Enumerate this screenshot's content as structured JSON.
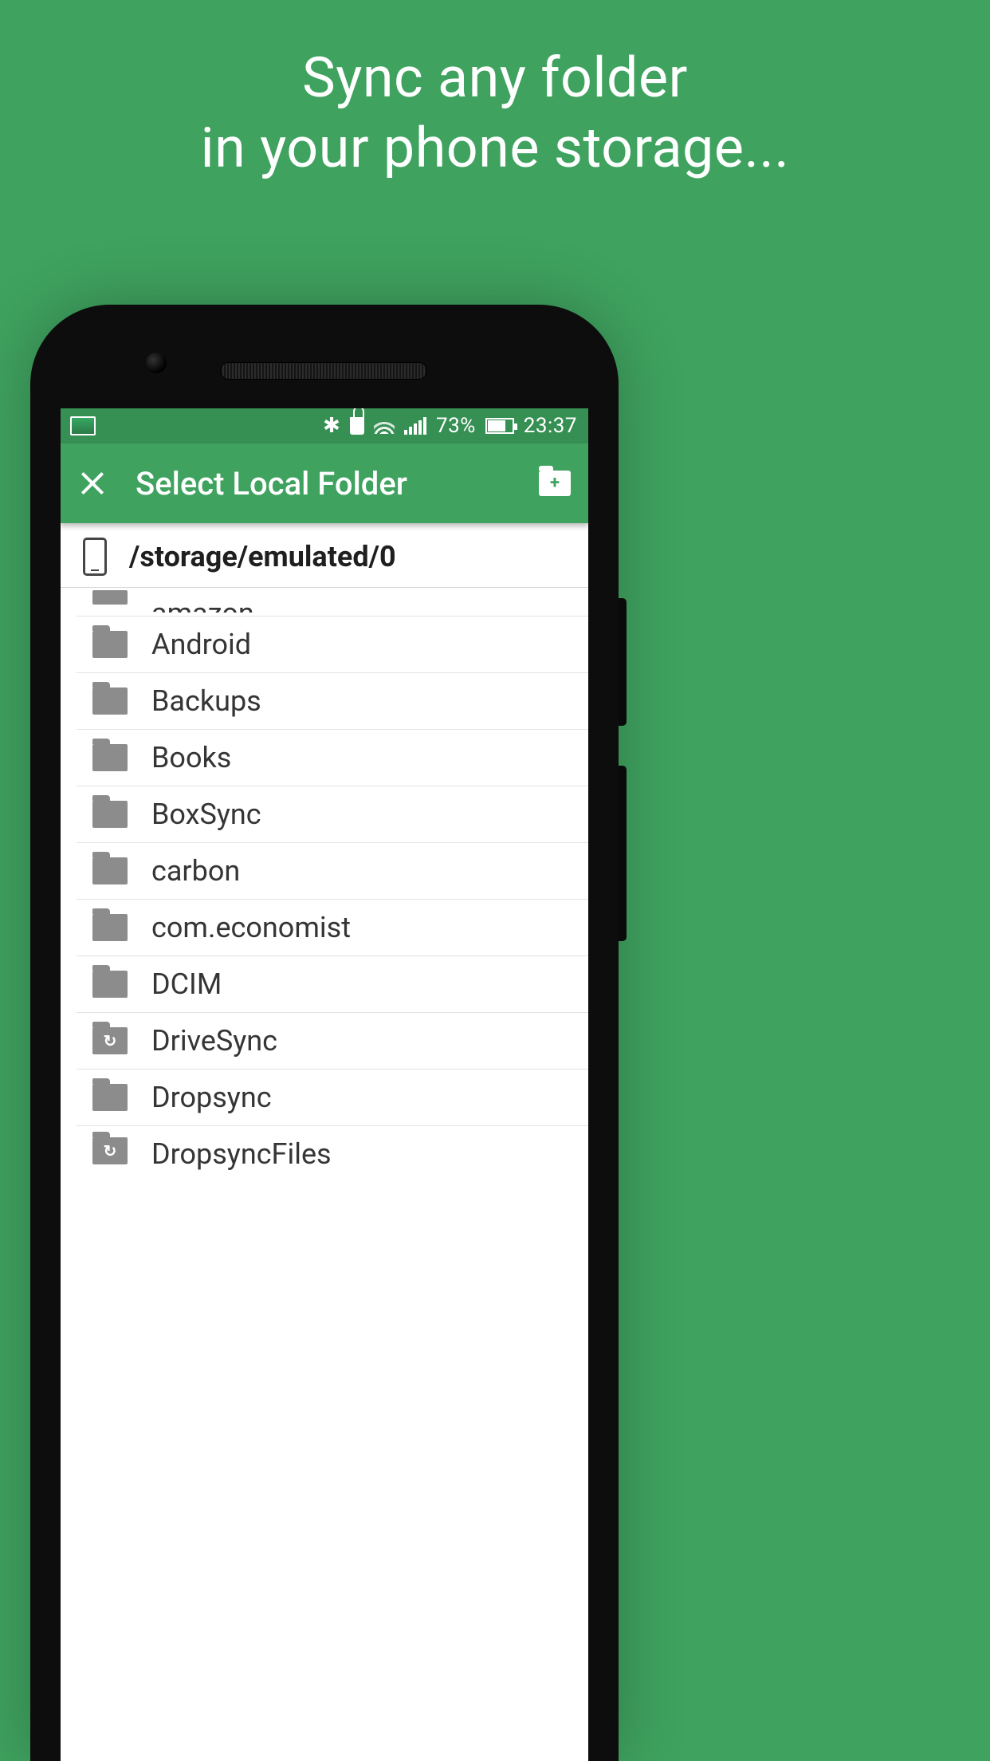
{
  "headline": "Sync any folder\nin your phone storage...",
  "statusbar": {
    "battery_pct": "73%",
    "time": "23:37"
  },
  "appbar": {
    "title": "Select Local Folder"
  },
  "path": "/storage/emulated/0",
  "folders": [
    {
      "name": "amazon",
      "sync": false,
      "cut": "top"
    },
    {
      "name": "Android",
      "sync": false
    },
    {
      "name": "Backups",
      "sync": false
    },
    {
      "name": "Books",
      "sync": false
    },
    {
      "name": "BoxSync",
      "sync": false
    },
    {
      "name": "carbon",
      "sync": false
    },
    {
      "name": "com.economist",
      "sync": false
    },
    {
      "name": "DCIM",
      "sync": false
    },
    {
      "name": "DriveSync",
      "sync": true
    },
    {
      "name": "Dropsync",
      "sync": false
    },
    {
      "name": "DropsyncFiles",
      "sync": true,
      "cut": "bottom"
    }
  ]
}
